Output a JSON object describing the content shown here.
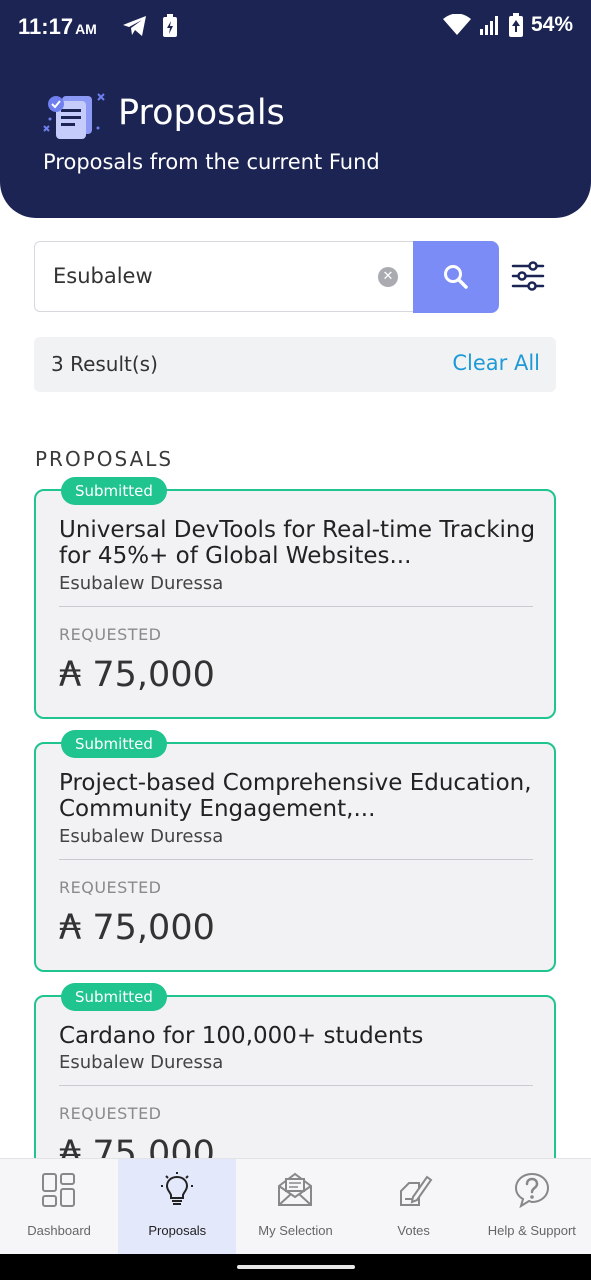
{
  "status_bar": {
    "time": "11:17",
    "ampm": "AM",
    "battery": "54%",
    "icons": [
      "telegram-icon",
      "battery-saver-icon",
      "wifi-icon",
      "signal-icon",
      "battery-icon"
    ]
  },
  "header": {
    "title": "Proposals",
    "subtitle": "Proposals from the current Fund",
    "background_color": "#1b2452"
  },
  "search": {
    "value": "Esubalew",
    "clear_icon": "clear-circle-icon",
    "button_icon": "search-icon",
    "filter_icon": "filter-sliders-icon",
    "button_color": "#7b8cf7"
  },
  "results": {
    "count_label": "3 Result(s)",
    "clear_all_label": "Clear All"
  },
  "section_label": "PROPOSALS",
  "proposals": [
    {
      "status": "Submitted",
      "title": "Universal DevTools for Real-time Tracking for 45%+ of Global Websites...",
      "author": "Esubalew Duressa",
      "requested_label": "REQUESTED",
      "amount": "₳ 75,000"
    },
    {
      "status": "Submitted",
      "title": "Project-based Comprehensive Education, Community Engagement,...",
      "author": "Esubalew Duressa",
      "requested_label": "REQUESTED",
      "amount": "₳ 75,000"
    },
    {
      "status": "Submitted",
      "title": "Cardano for 100,000+ students",
      "author": "Esubalew Duressa",
      "requested_label": "REQUESTED",
      "amount": "₳ 75,000"
    }
  ],
  "bottom_nav": {
    "items": [
      {
        "label": "Dashboard",
        "icon": "dashboard-grid-icon"
      },
      {
        "label": "Proposals",
        "icon": "lightbulb-icon",
        "active": true
      },
      {
        "label": "My Selection",
        "icon": "envelope-list-icon"
      },
      {
        "label": "Votes",
        "icon": "ballot-pen-icon"
      },
      {
        "label": "Help & Support",
        "icon": "help-question-icon"
      }
    ]
  },
  "colors": {
    "accent_green": "#1fc48f",
    "link_blue": "#1e9ad6",
    "nav_active_bg": "#e4e8fb"
  }
}
